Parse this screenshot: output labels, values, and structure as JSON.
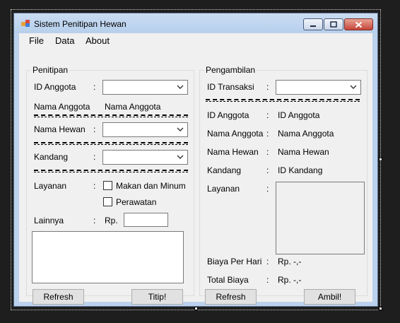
{
  "window": {
    "title": "Sistem Penitipan Hewan"
  },
  "menu": {
    "items": [
      "File",
      "Data",
      "About"
    ]
  },
  "penitipan": {
    "group_title": "Penitipan",
    "id_anggota_label": "ID Anggota",
    "nama_anggota_label": "Nama Anggota",
    "nama_anggota_value": "Nama Anggota",
    "nama_hewan_label": "Nama Hewan",
    "kandang_label": "Kandang",
    "layanan_label": "Layanan",
    "option_makan": "Makan dan Minum",
    "option_perawatan": "Perawatan",
    "lainnya_label": "Lainnya",
    "rp_label": "Rp.",
    "colon": ":",
    "refresh_button": "Refresh",
    "titip_button": "Titip!"
  },
  "pengambilan": {
    "group_title": "Pengambilan",
    "id_transaksi_label": "ID Transaksi",
    "id_anggota_label": "ID Anggota",
    "id_anggota_value": "ID Anggota",
    "nama_anggota_label": "Nama Anggota",
    "nama_anggota_value": "Nama Anggota",
    "nama_hewan_label": "Nama Hewan",
    "nama_hewan_value": "Nama Hewan",
    "kandang_label": "Kandang",
    "kandang_value": "ID Kandang",
    "layanan_label": "Layanan",
    "biaya_label": "Biaya Per Hari",
    "biaya_value": "Rp. -,-",
    "total_label": "Total Biaya",
    "total_value": "Rp. -,-",
    "colon": ":",
    "refresh_button": "Refresh",
    "ambil_button": "Ambil!"
  }
}
